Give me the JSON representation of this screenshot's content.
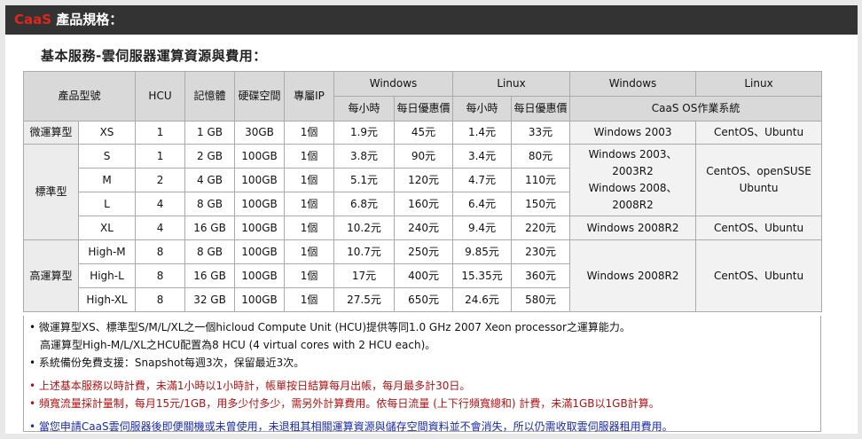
{
  "header": {
    "brand": "CaaS",
    "title": " 產品規格："
  },
  "subtitle": "基本服務-雲伺服器運算資源與費用：",
  "table": {
    "headers": {
      "model": "產品型號",
      "hcu": "HCU",
      "memory": "記憶體",
      "disk": "硬碟空間",
      "ip": "專屬IP",
      "windows": "Windows",
      "linux": "Linux",
      "hourly": "每小時",
      "daily": "每日優惠價",
      "os_windows": "Windows",
      "os_linux": "Linux",
      "os_label": "CaaS OS作業系統"
    },
    "groups": {
      "micro": "微運算型",
      "standard": "標準型",
      "high": "高運算型"
    },
    "rows": [
      {
        "size": "XS",
        "hcu": "1",
        "mem": "1 GB",
        "disk": "30GB",
        "ip": "1個",
        "win_h": "1.9元",
        "win_d": "45元",
        "lin_h": "1.4元",
        "lin_d": "33元"
      },
      {
        "size": "S",
        "hcu": "1",
        "mem": "2 GB",
        "disk": "100GB",
        "ip": "1個",
        "win_h": "3.8元",
        "win_d": "90元",
        "lin_h": "3.4元",
        "lin_d": "80元"
      },
      {
        "size": "M",
        "hcu": "2",
        "mem": "4 GB",
        "disk": "100GB",
        "ip": "1個",
        "win_h": "5.1元",
        "win_d": "120元",
        "lin_h": "4.7元",
        "lin_d": "110元"
      },
      {
        "size": "L",
        "hcu": "4",
        "mem": "8 GB",
        "disk": "100GB",
        "ip": "1個",
        "win_h": "6.8元",
        "win_d": "160元",
        "lin_h": "6.4元",
        "lin_d": "150元"
      },
      {
        "size": "XL",
        "hcu": "4",
        "mem": "16 GB",
        "disk": "100GB",
        "ip": "1個",
        "win_h": "10.2元",
        "win_d": "240元",
        "lin_h": "9.4元",
        "lin_d": "220元"
      },
      {
        "size": "High-M",
        "hcu": "8",
        "mem": "8 GB",
        "disk": "100GB",
        "ip": "1個",
        "win_h": "10.7元",
        "win_d": "250元",
        "lin_h": "9.85元",
        "lin_d": "230元"
      },
      {
        "size": "High-L",
        "hcu": "8",
        "mem": "16 GB",
        "disk": "100GB",
        "ip": "1個",
        "win_h": "17元",
        "win_d": "400元",
        "lin_h": "15.35元",
        "lin_d": "360元"
      },
      {
        "size": "High-XL",
        "hcu": "8",
        "mem": "32 GB",
        "disk": "100GB",
        "ip": "1個",
        "win_h": "27.5元",
        "win_d": "650元",
        "lin_h": "24.6元",
        "lin_d": "580元"
      }
    ],
    "os": {
      "micro_win": "Windows 2003",
      "micro_lin": "CentOS、Ubuntu",
      "std_win_1": "Windows 2003、",
      "std_win_2": "2003R2",
      "std_win_3": "Windows 2008、",
      "std_win_4": "2008R2",
      "std_lin_1": "CentOS、openSUSE",
      "std_lin_2": "Ubuntu",
      "xl_win": "Windows 2008R2",
      "xl_lin": "CentOS、Ubuntu",
      "high_win": "Windows 2008R2",
      "high_lin": "CentOS、Ubuntu"
    }
  },
  "notes": {
    "n1": "• 微運算型XS、標準型S/M/L/XL之一個hicloud Compute Unit (HCU)提供等同1.0 GHz 2007 Xeon processor之運算能力。",
    "n1b": "高運算型High-M/L/XL之HCU配置為8 HCU (4 virtual cores with 2 HCU each)。",
    "n2": "• 系統備份免費支援：Snapshot每週3次，保留最近3次。",
    "n3": "• 上述基本服務以時計費，未滿1小時以1小時計，帳單按日結算每月出帳，每月最多計30日。",
    "n4": "• 頻寬流量採計量制，每月15元/1GB，用多少付多少，需另外計算費用。依每日流量 (上下行頻寬總和) 計費，未滿1GB以1GB計算。",
    "n5_pre": "• 當您申請",
    "n5_brand": "CaaS",
    "n5_post": "雲伺服器後即便關機或未曾使用，未退租其相關運算資源與儲存空間資料並不會消失，所以仍需收取雲伺服器租用費用。"
  },
  "colors": {
    "titlebar": "#333333",
    "brand": "#e0261b",
    "header_bg": "#d9d9d9",
    "warn": "#b01212",
    "info": "#1a2aa8"
  }
}
